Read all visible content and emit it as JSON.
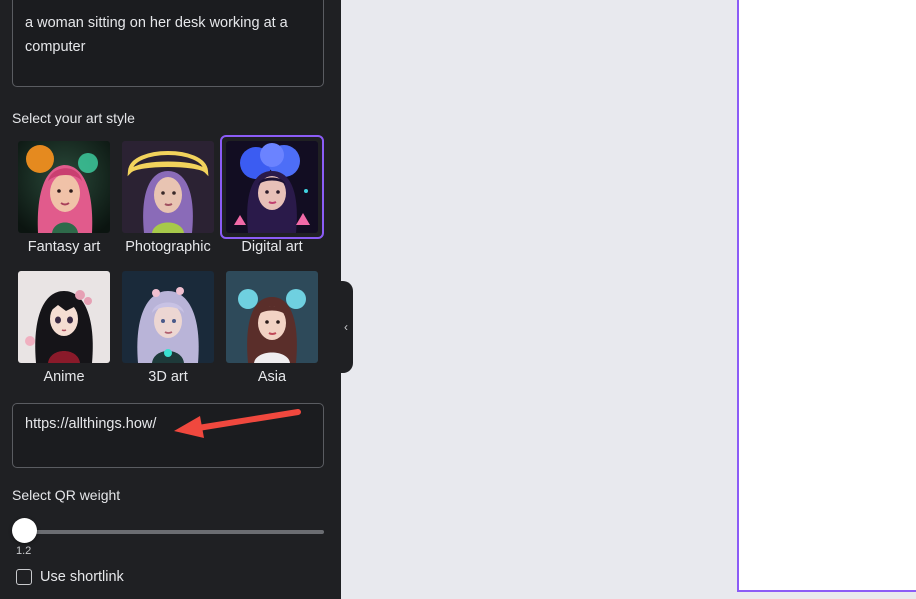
{
  "prompt": {
    "text": "a woman sitting on her desk working at a computer"
  },
  "art_style": {
    "heading": "Select your art style",
    "styles": [
      {
        "label": "Fantasy art",
        "icon": "fantasy-art-thumbnail"
      },
      {
        "label": "Photographic",
        "icon": "photographic-thumbnail"
      },
      {
        "label": "Digital art",
        "icon": "digital-art-thumbnail",
        "selected": true
      },
      {
        "label": "Anime",
        "icon": "anime-thumbnail"
      },
      {
        "label": "3D art",
        "icon": "3d-art-thumbnail"
      },
      {
        "label": "Asia",
        "icon": "asia-thumbnail"
      }
    ]
  },
  "url_input": {
    "value": "https://allthings.how/"
  },
  "qr_weight": {
    "heading": "Select QR weight",
    "value": "1.2",
    "level_fraction": 0.0
  },
  "shortlink": {
    "label": "Use shortlink",
    "checked": false
  },
  "colors": {
    "panel_bg": "#1f2023",
    "accent": "#8b5cf6",
    "canvas_bg": "#e8e9ee",
    "annotation_arrow": "#f0483e"
  },
  "icons": {
    "collapse": "chevron-left-icon",
    "annotation": "red-arrow-icon"
  }
}
